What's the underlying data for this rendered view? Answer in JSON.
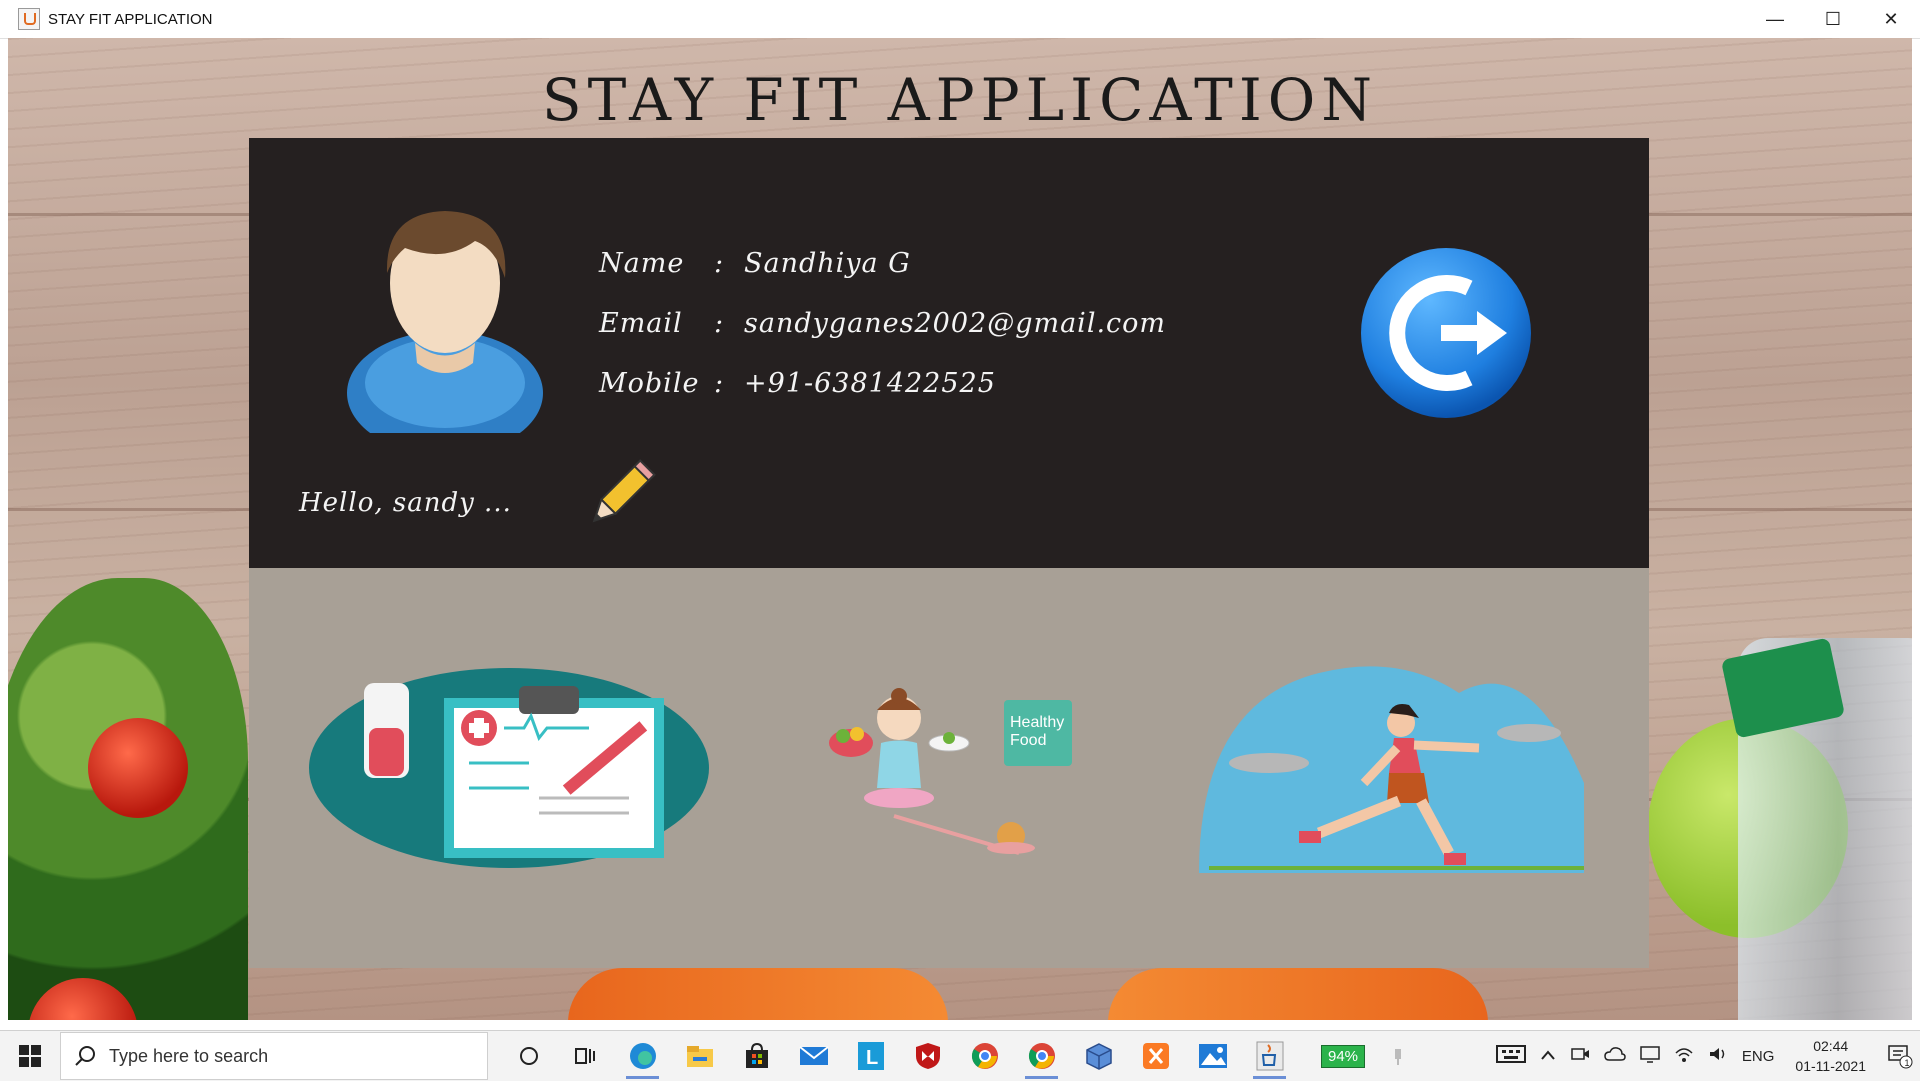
{
  "window": {
    "title": "STAY FIT APPLICATION",
    "controls": {
      "minimize": "—",
      "maximize": "☐",
      "close": "✕"
    }
  },
  "app": {
    "heading": "STAY FIT APPLICATION",
    "profile": {
      "name_label": "Name",
      "name_value": "Sandhiya G",
      "email_label": "Email",
      "email_value": "sandyganes2002@gmail.com",
      "mobile_label": "Mobile",
      "mobile_value": "+91-6381422525",
      "colon": ":",
      "greeting": "Hello, sandy ...",
      "avatar_icon": "user-avatar-icon",
      "edit_icon": "pencil-icon",
      "logout_icon": "logout-icon"
    },
    "features": {
      "health_icon": "medical-report-icon",
      "food_label_line1": "Healthy",
      "food_label_line2": "Food",
      "exercise_icon": "running-woman-icon"
    }
  },
  "taskbar": {
    "search_placeholder": "Type here to search",
    "battery": "94%",
    "language": "ENG",
    "time": "02:44",
    "date": "01-11-2021",
    "notification_count": "1"
  },
  "colors": {
    "profile_panel_bg": "#252020",
    "features_panel_bg": "#a8a096",
    "logout_blue": "#1f7fe0"
  }
}
